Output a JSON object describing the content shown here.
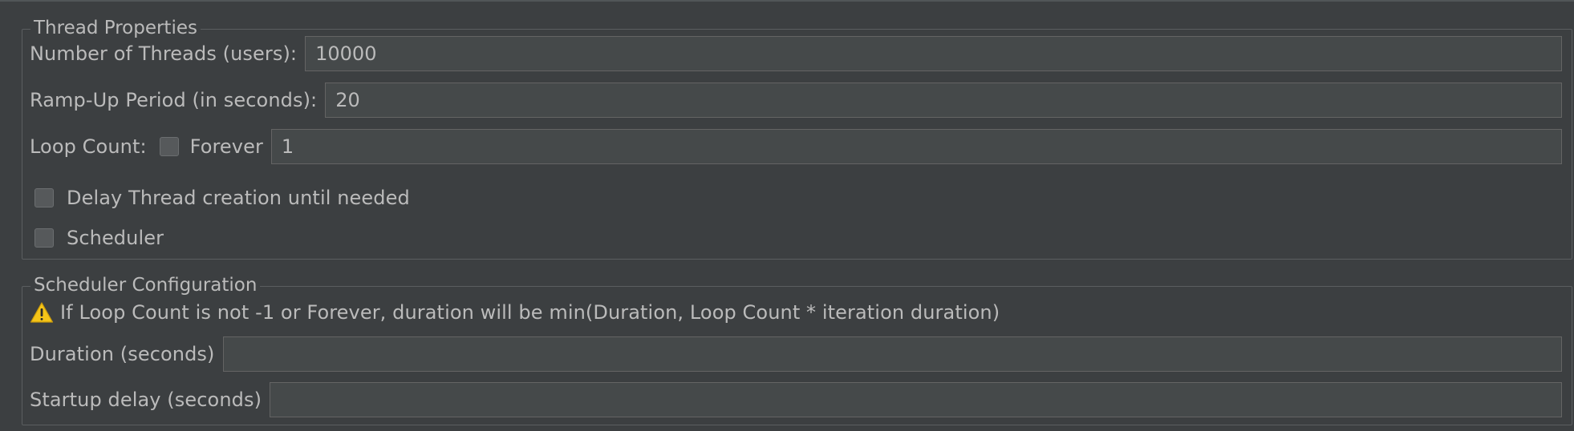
{
  "thread_properties": {
    "title": "Thread Properties",
    "num_threads_label": "Number of Threads (users):",
    "num_threads_value": "10000",
    "ramp_up_label": "Ramp-Up Period (in seconds):",
    "ramp_up_value": "20",
    "loop_count_label": "Loop Count:",
    "forever_label": "Forever",
    "forever_checked": false,
    "loop_count_value": "1",
    "delay_creation_label": "Delay Thread creation until needed",
    "delay_creation_checked": false,
    "scheduler_label": "Scheduler",
    "scheduler_checked": false
  },
  "scheduler_configuration": {
    "title": "Scheduler Configuration",
    "warning_icon": "warning-triangle-icon",
    "warning_text": "If Loop Count is not -1 or Forever, duration will be min(Duration, Loop Count * iteration duration)",
    "duration_label": "Duration (seconds)",
    "duration_value": "",
    "startup_delay_label": "Startup delay (seconds)",
    "startup_delay_value": ""
  },
  "colors": {
    "background": "#3c3f41",
    "field_background": "#45494a",
    "text": "#bbbbbb",
    "warning_yellow": "#f5c518"
  }
}
